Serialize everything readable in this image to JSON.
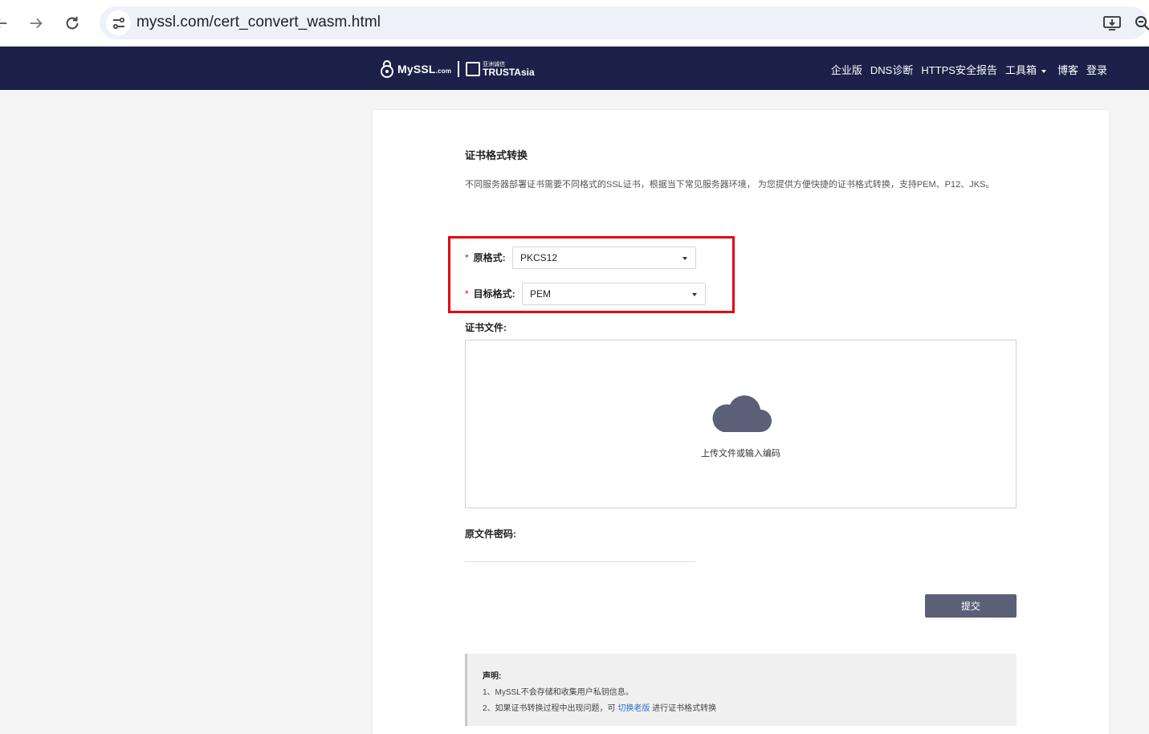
{
  "browser": {
    "url": "myssl.com/cert_convert_wasm.html"
  },
  "header": {
    "logo_myssl": "MySSL",
    "logo_com": ".com",
    "logo_trustasia_cn": "亚洲诚信",
    "logo_trustasia_en": "TRUSTAsia",
    "nav": {
      "enterprise": "企业版",
      "dns": "DNS诊断",
      "https_report": "HTTPS安全报告",
      "tools": "工具箱",
      "blog": "博客",
      "login": "登录"
    }
  },
  "main": {
    "title": "证书格式转换",
    "description": "不同服务器部署证书需要不同格式的SSL证书，根据当下常见服务器环境， 为您提供方便快捷的证书格式转换，支持PEM、P12、JKS。",
    "source_format": {
      "required_mark": "*",
      "label": "原格式:",
      "value": "PKCS12"
    },
    "target_format": {
      "required_mark": "*",
      "label": "目标格式:",
      "value": "PEM"
    },
    "cert_file": {
      "label": "证书文件:",
      "upload_text": "上传文件或输入编码"
    },
    "password": {
      "label": "原文件密码:"
    },
    "submit_label": "提交",
    "notice": {
      "title": "声明:",
      "item1": "1、MySSL不会存储和收集用户私钥信息。",
      "item2_prefix": "2、如果证书转换过程中出现问题，可 ",
      "item2_link": "切换老版",
      "item2_suffix": " 进行证书格式转换"
    }
  },
  "colors": {
    "header_bg": "#1b2148",
    "highlight": "#e60012",
    "submit_bg": "#5b6078",
    "cloud": "#5b6078",
    "link": "#2a6fc9"
  }
}
